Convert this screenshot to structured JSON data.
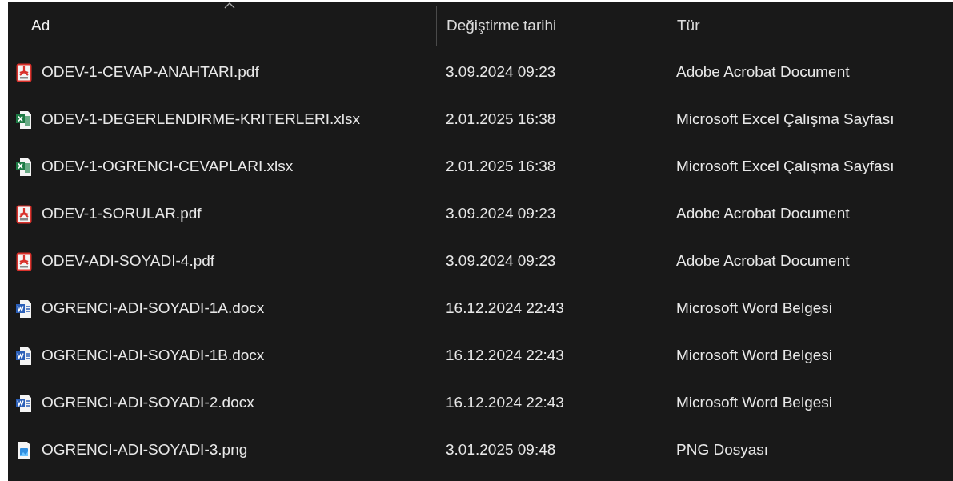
{
  "columns": [
    {
      "label": "Ad",
      "sorted": true
    },
    {
      "label": "Değiştirme tarihi",
      "sorted": false
    },
    {
      "label": "Tür",
      "sorted": false
    }
  ],
  "files": [
    {
      "kind": "pdf",
      "name": "ODEV-1-CEVAP-ANAHTARI.pdf",
      "modified": "3.09.2024 09:23",
      "type": "Adobe Acrobat Document"
    },
    {
      "kind": "excel",
      "name": "ODEV-1-DEGERLENDIRME-KRITERLERI.xlsx",
      "modified": "2.01.2025 16:38",
      "type": "Microsoft Excel Çalışma Sayfası"
    },
    {
      "kind": "excel",
      "name": "ODEV-1-OGRENCI-CEVAPLARI.xlsx",
      "modified": "2.01.2025 16:38",
      "type": "Microsoft Excel Çalışma Sayfası"
    },
    {
      "kind": "pdf",
      "name": "ODEV-1-SORULAR.pdf",
      "modified": "3.09.2024 09:23",
      "type": "Adobe Acrobat Document"
    },
    {
      "kind": "pdf",
      "name": "ODEV-ADI-SOYADI-4.pdf",
      "modified": "3.09.2024 09:23",
      "type": "Adobe Acrobat Document"
    },
    {
      "kind": "word",
      "name": "OGRENCI-ADI-SOYADI-1A.docx",
      "modified": "16.12.2024 22:43",
      "type": "Microsoft Word Belgesi"
    },
    {
      "kind": "word",
      "name": "OGRENCI-ADI-SOYADI-1B.docx",
      "modified": "16.12.2024 22:43",
      "type": "Microsoft Word Belgesi"
    },
    {
      "kind": "word",
      "name": "OGRENCI-ADI-SOYADI-2.docx",
      "modified": "16.12.2024 22:43",
      "type": "Microsoft Word Belgesi"
    },
    {
      "kind": "image",
      "name": "OGRENCI-ADI-SOYADI-3.png",
      "modified": "3.01.2025 09:48",
      "type": "PNG Dosyası"
    }
  ]
}
